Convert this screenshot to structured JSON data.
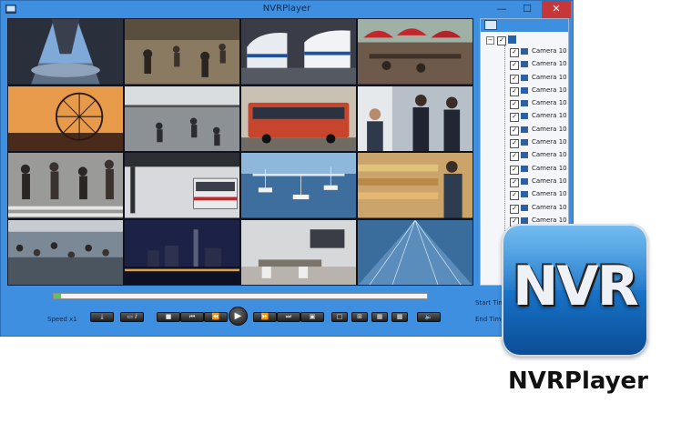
{
  "window": {
    "title": "NVRPlayer",
    "controls": {
      "minimize": "—",
      "maximize": "☐",
      "close": "✕"
    }
  },
  "feeds": [
    {
      "scene": "eiffel-tower"
    },
    {
      "scene": "street-crowd"
    },
    {
      "scene": "bullet-trains"
    },
    {
      "scene": "outdoor-cafe"
    },
    {
      "scene": "ferris-wheel-sunset"
    },
    {
      "scene": "station-concourse"
    },
    {
      "scene": "tour-bus"
    },
    {
      "scene": "shop-people"
    },
    {
      "scene": "crosswalk-crowd"
    },
    {
      "scene": "bus-station"
    },
    {
      "scene": "harbor"
    },
    {
      "scene": "grocery-store"
    },
    {
      "scene": "market-crowd"
    },
    {
      "scene": "city-night"
    },
    {
      "scene": "office-room"
    },
    {
      "scene": "glass-atrium"
    }
  ],
  "tree": {
    "root_expander": "−",
    "items": [
      {
        "label": "Camera 10"
      },
      {
        "label": "Camera 10"
      },
      {
        "label": "Camera 10"
      },
      {
        "label": "Camera 10"
      },
      {
        "label": "Camera 10"
      },
      {
        "label": "Camera 10"
      },
      {
        "label": "Camera 10"
      },
      {
        "label": "Camera 10"
      },
      {
        "label": "Camera 10"
      },
      {
        "label": "Camera 10"
      },
      {
        "label": "Camera 10"
      },
      {
        "label": "Camera 10"
      },
      {
        "label": "Camera 10"
      },
      {
        "label": "Camera 10"
      },
      {
        "label": "Camera 10"
      }
    ]
  },
  "playback": {
    "progress": 0.02,
    "speed_label": "Speed x1",
    "start_time_label": "Start Time:",
    "end_time_label": "End Time:",
    "buttons": {
      "download": "⤓",
      "snapshot": "▭ ⅈ",
      "stop": "■",
      "prev": "⏮",
      "slow": "⏪",
      "play": "▶",
      "fast": "⏩",
      "next": "⏭",
      "frame": "▣",
      "layout1": "□",
      "layout4": "⊞",
      "layout9": "▦",
      "layout16": "▩",
      "volume": "🔈"
    }
  },
  "logo": {
    "mark": "NVR"
  },
  "brand": {
    "name": "NVRPlayer"
  },
  "colors": {
    "window": "#3f8fe0",
    "progress": "#5cc45c",
    "logo": "#1770c4"
  }
}
